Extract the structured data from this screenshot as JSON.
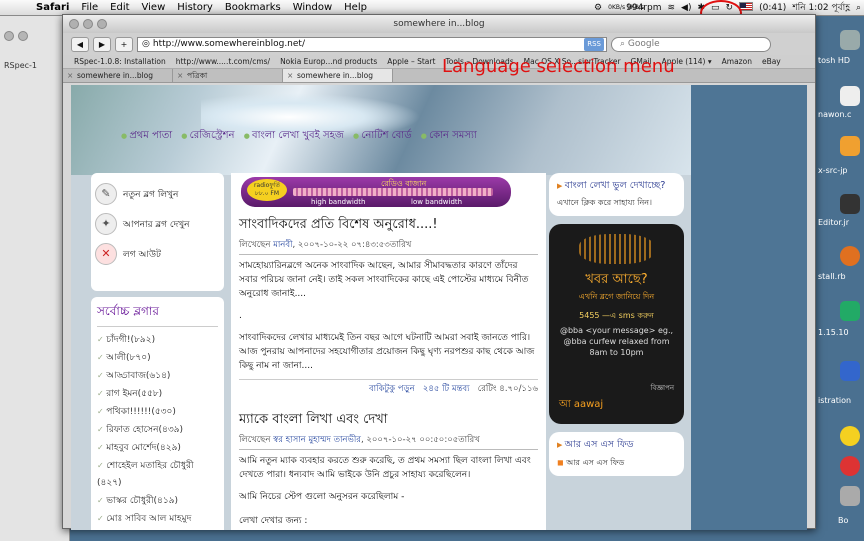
{
  "menubar": {
    "app": "Safari",
    "items": [
      "File",
      "Edit",
      "View",
      "History",
      "Bookmarks",
      "Window",
      "Help"
    ],
    "status": {
      "net": "0KB/s 1KB/s",
      "fan": "994rpm",
      "battery": "(0:41)",
      "clock": "শনি 1:02 পূর্বাহ্ণ"
    }
  },
  "annotation": "Language selection menu",
  "bgwin": {
    "tab": "RSpec-1"
  },
  "window": {
    "title": "somewhere in...blog",
    "url": "http://www.somewhereinblog.net/",
    "rss": "RSS",
    "search_placeholder": "Google",
    "back": "◀",
    "forward": "▶",
    "add": "+",
    "bookmarks": [
      "RSpec-1.0.8: Installation",
      "http://www.....t.com/cms/",
      "Nokia Europ...nd products",
      "Apple – Start",
      "Tools – Downloads",
      "Mac OS X So...sionTracker",
      "GMail",
      "Apple (114) ▾",
      "Amazon",
      "eBay"
    ],
    "tabs": [
      "somewhere in...blog",
      "পত্রিকা",
      "somewhere in...blog"
    ]
  },
  "page": {
    "nav": [
      "প্রথম পাতা",
      "রেজিস্ট্রেশন",
      "বাংলা লেখা খুবই সহজ",
      "নোটিশ বোর্ড",
      "কোন সমস্যা"
    ],
    "left_nav": [
      {
        "label": "নতুন ব্লগ লিখুন",
        "icon": "✎"
      },
      {
        "label": "আপনার ব্লগ দেখুন",
        "icon": "✦"
      },
      {
        "label": "লগ আউট",
        "icon": "✕"
      }
    ],
    "top_bloggers_title": "সর্বোচ্চ ব্লগার",
    "bloggers": [
      "চাঁদগী!(৮৯২)",
      "আলী(৮৭০)",
      "আড্ডাবাজ(৬১৪)",
      "রাগ ইমন(৫৫৮)",
      "পথিকা!!!!!!(৫৩০)",
      "রিফাত হোসেন(৪৩৯)",
      "মাহবুব মোর্শেদ(৪২৯)",
      "শোহেইল মতাহির চৌধুরী (৪২৭)",
      "ভাস্কর চৌধুরী(৪১৯)",
      "মোঃ সাবিব আল মাহমুদ (৪১১)"
    ],
    "radio": {
      "logo": "radioফুর্তি ৮৮.০ FM",
      "title": "রেডিও বাজান",
      "high": "high bandwidth",
      "low": "low bandwidth"
    },
    "posts": [
      {
        "title": "সাংবাদিকদের প্রতি বিশেষ অনুরোধ....!",
        "meta_prefix": "লিখেছেন",
        "author": "মানবী",
        "meta_date": ", ২০০৭-১০-২২ ০৭:৪৩:৫৩তারিখ",
        "body1": "সামহোয়্যারিনব্লগে অনেক সাংবাদিক আছেন, আমার সীমাবদ্ধতার কারণে তাঁদের সবার পরিচয় জানা নেই। তাই সকল সাংবাদিকের কাছে এই পোস্টের মাধ্যমে বিনীত অনুরোধ জানাই....",
        "dot": ".",
        "body2": "সাংবাদিকদের লেখার মাধ্যমেই তিন বছর আগে ঘটনাটি আমরা সবাই জানতে পারি। আজ পুনরায় আপনাদের সহযোগীতার প্রয়োজন কিছু ঘৃণ্য নরপশুর কাছ থেকে আজ কিছু নাম না জানা....",
        "more": "বাকিটুকু পড়ুন",
        "comments": "২৪৫ টি মন্তব্য",
        "rating": "রেটিং ৪.৭০/১১৬"
      },
      {
        "title": "ম্যাকে বাংলা লিখা এবং দেখা",
        "meta_prefix": "লিখেছেন",
        "author": "স্বর হাসান মুহাম্মদ তানভীর",
        "meta_date": ", ২০০৭-১০-২৭ ০০:৫০:০৫তারিখ",
        "body1": "আমি নতুন ম্যাক ব্যবহার করতে শুরু করেছি, ত প্রথম সমস্যা ছিল বাংলা লিখা এবং দেখতে পারা। ধন্যবাদ আমি ভাইকে উনি প্রচুর সাহায্য করেছিলেন।",
        "body2": "আমি নিচের স্টেপ গুলো অনুসরন করেছিলাম -",
        "body3": "লেখা দেখার জন্য :"
      }
    ],
    "right": {
      "help_title": "বাংলা লেখা ভুল দেখাচ্ছে?",
      "help_text": "এখানে ক্লিক করে সাহায্য নিন।",
      "ad": {
        "headline": "খবর আছে?",
        "sub": "এখনি ব্লগে জানিয়ে দিন",
        "number": "5455 —এ sms করুন",
        "msg": "@bba <your message> eg., @bba curfew relaxed from 8am to 10pm",
        "brand": "আ aawaj",
        "adv": "বিজ্ঞাপন"
      },
      "rss_title": "আর এস এস ফিড",
      "rss_item": "আর এস এস ফিড"
    }
  },
  "dock": {
    "labels": [
      "tosh HD",
      "nawon.c",
      "x-src-jp",
      "Editor.jr",
      "stall.rb",
      "1.15.10",
      "istration",
      "Bo"
    ]
  },
  "colors": {
    "accent_red": "#e01010",
    "nav_purple": "#5a2a8a",
    "link_blue": "#2a4aa0"
  }
}
